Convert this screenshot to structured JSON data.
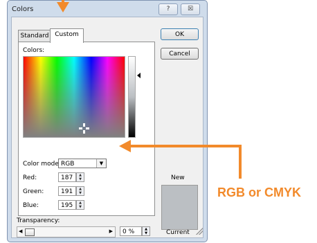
{
  "dialog": {
    "title": "Colors",
    "help_glyph": "?",
    "close_glyph": "☒"
  },
  "tabs": [
    {
      "label": "Standard"
    },
    {
      "label": "Custom"
    }
  ],
  "custom": {
    "colors_label": "Colors:",
    "color_model_label": "Color model:",
    "color_model_value": "RGB",
    "red_label": "Red:",
    "red_value": "187",
    "green_label": "Green:",
    "green_value": "191",
    "blue_label": "Blue:",
    "blue_value": "195",
    "transparency_label": "Transparency:",
    "transparency_value": "0 %"
  },
  "buttons": {
    "ok": "OK",
    "cancel": "Cancel"
  },
  "preview": {
    "new_label": "New",
    "current_label": "Current",
    "current_color": "#bbbfc3"
  },
  "annotation": {
    "text": "RGB or CMYK",
    "color": "#f28a2b"
  }
}
